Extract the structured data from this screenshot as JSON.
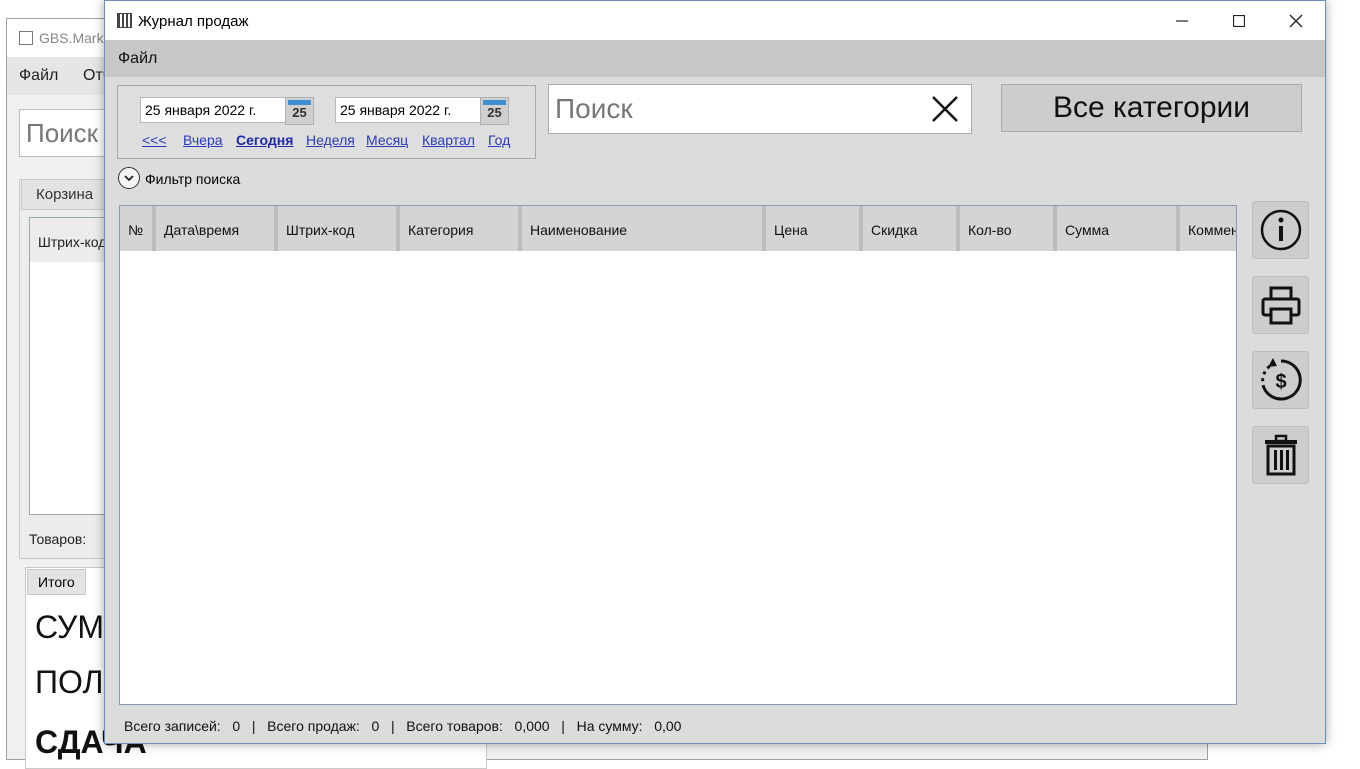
{
  "background_window": {
    "title": "GBS.Marke",
    "menu": [
      "Файл",
      "Отч"
    ],
    "search_placeholder": "Поиск",
    "cart_tab": "Корзина",
    "cart_column": "Штрих-код",
    "goods_label": "Товаров:",
    "total_tab": "Итого",
    "big_labels": [
      "СУМ",
      "ПОЛ",
      "СДАЧА"
    ]
  },
  "window": {
    "title": "Журнал продаж",
    "controls": {
      "minimize": "─",
      "maximize": "☐",
      "close": "✕"
    }
  },
  "menu": {
    "file": "Файл"
  },
  "dates": {
    "from": "25 января 2022 г.",
    "to": "25 января 2022 г.",
    "calendar_day": "25"
  },
  "period_links": [
    "<<<",
    "Вчера",
    "Сегодня",
    "Неделя",
    "Месяц",
    "Квартал",
    "Год"
  ],
  "search": {
    "placeholder": "Поиск",
    "value": ""
  },
  "category_button": "Все категории",
  "filter_label": "Фильтр поиска",
  "table": {
    "columns": [
      "№",
      "Дата\\время",
      "Штрих-код",
      "Категория",
      "Наименование",
      "Цена",
      "Скидка",
      "Кол-во",
      "Сумма",
      "Коммен"
    ],
    "rows": []
  },
  "side_buttons": [
    "info-icon",
    "printer-icon",
    "refund-icon",
    "trash-icon"
  ],
  "status": {
    "records_label": "Всего записей:",
    "records": "0",
    "sales_label": "Всего продаж:",
    "sales": "0",
    "goods_label": "Всего товаров:",
    "goods": "0,000",
    "sum_label": "На сумму:",
    "sum": "0,00",
    "sep": "|"
  }
}
